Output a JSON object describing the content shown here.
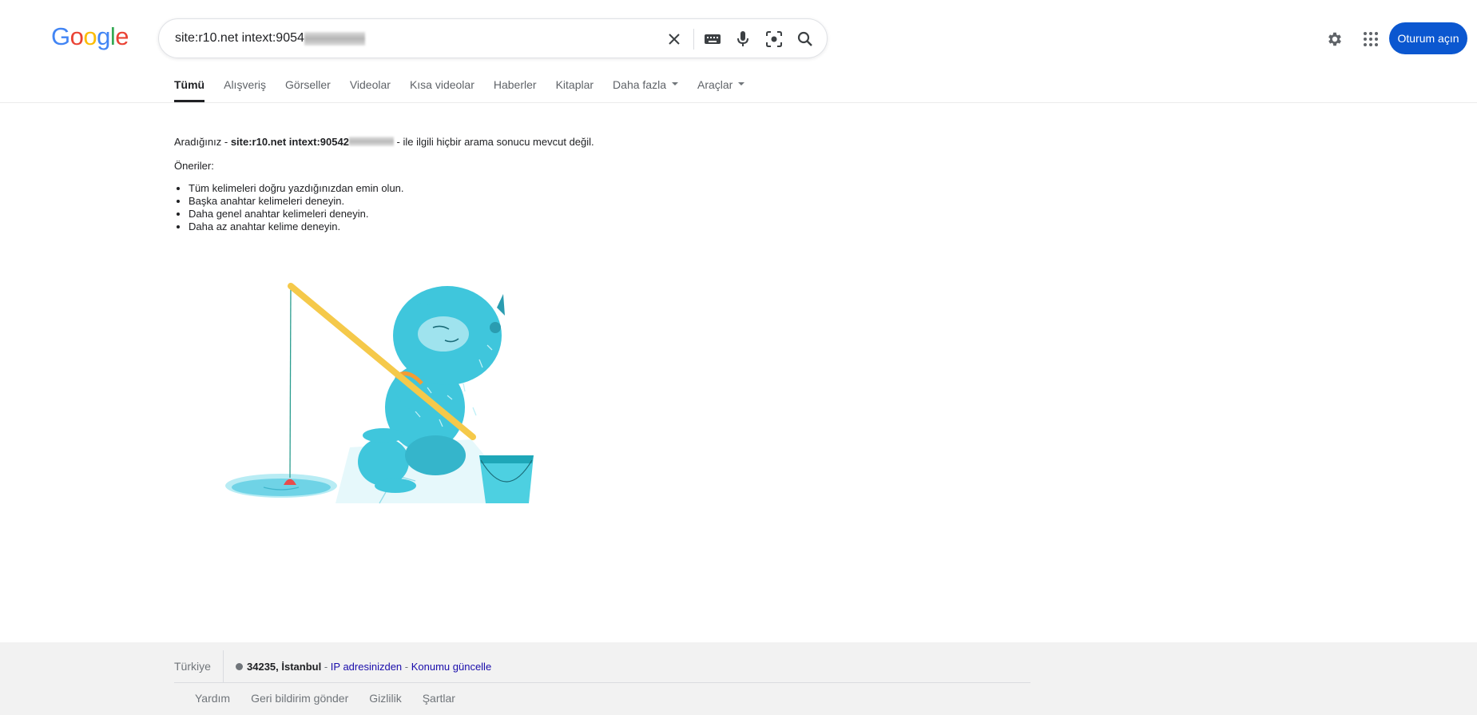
{
  "search": {
    "query": "site:r10.net intext:9054",
    "clear_label": "✕"
  },
  "header": {
    "signin_label": "Oturum açın"
  },
  "tabs": [
    {
      "label": "Tümü"
    },
    {
      "label": "Alışveriş"
    },
    {
      "label": "Görseller"
    },
    {
      "label": "Videolar"
    },
    {
      "label": "Kısa videolar"
    },
    {
      "label": "Haberler"
    },
    {
      "label": "Kitaplar"
    },
    {
      "label": "Daha fazla"
    },
    {
      "label": "Araçlar"
    }
  ],
  "results": {
    "prefix": "Aradığınız - ",
    "query_bold": "site:r10.net intext:90542",
    "suffix": " - ile ilgili hiçbir arama sonucu mevcut değil.",
    "suggestions_title": "Öneriler:",
    "suggestions": [
      "Tüm kelimeleri doğru yazdığınızdan emin olun.",
      "Başka anahtar kelimeleri deneyin.",
      "Daha genel anahtar kelimeleri deneyin.",
      "Daha az anahtar kelime deneyin."
    ]
  },
  "footer": {
    "country": "Türkiye",
    "location": "34235, İstanbul",
    "sep1": " - ",
    "ip_link": "IP adresinizden",
    "sep2": " - ",
    "update_link": "Konumu güncelle",
    "links": [
      "Yardım",
      "Geri bildirim gönder",
      "Gizlilik",
      "Şartlar"
    ]
  },
  "colors": {
    "signin_bg": "#0b57d0",
    "link": "#1a0dab",
    "footer_bg": "#f2f2f2",
    "yeti": "#3fc6dc",
    "rod": "#f5c94a"
  }
}
